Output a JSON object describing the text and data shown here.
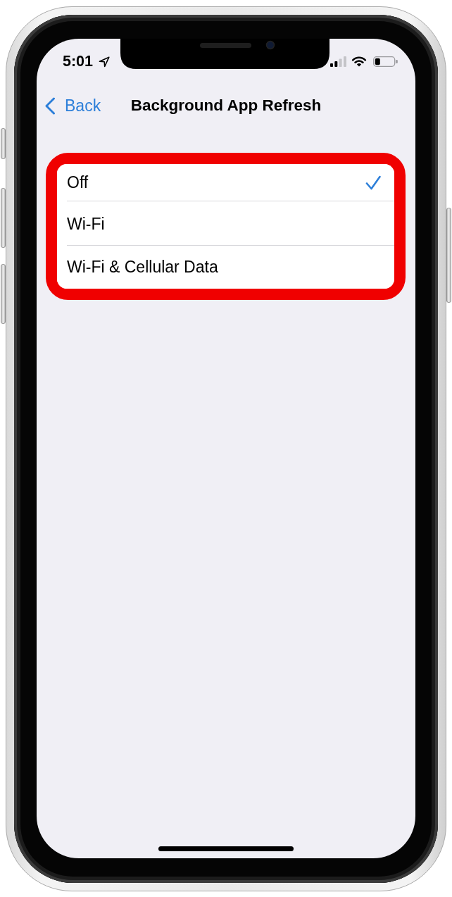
{
  "status_bar": {
    "time": "5:01"
  },
  "nav": {
    "back": "Back",
    "title": "Background App Refresh"
  },
  "settings_group": {
    "highlighted": true,
    "options": [
      {
        "label": "Off",
        "selected": true
      },
      {
        "label": "Wi-Fi",
        "selected": false
      },
      {
        "label": "Wi-Fi & Cellular Data",
        "selected": false
      }
    ]
  }
}
